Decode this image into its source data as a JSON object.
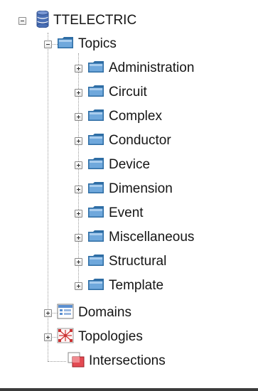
{
  "tree": {
    "root": {
      "label": "TTELECTRIC",
      "icon": "database-icon",
      "expanded": true
    },
    "topics": {
      "label": "Topics",
      "icon": "folder-icon",
      "expanded": true,
      "children": [
        {
          "label": "Administration"
        },
        {
          "label": "Circuit"
        },
        {
          "label": "Complex"
        },
        {
          "label": "Conductor"
        },
        {
          "label": "Device"
        },
        {
          "label": "Dimension"
        },
        {
          "label": "Event"
        },
        {
          "label": "Miscellaneous"
        },
        {
          "label": "Structural"
        },
        {
          "label": "Template"
        }
      ]
    },
    "domains": {
      "label": "Domains",
      "icon": "domains-icon"
    },
    "topologies": {
      "label": "Topologies",
      "icon": "topologies-icon"
    },
    "intersections": {
      "label": "Intersections",
      "icon": "intersections-icon"
    }
  },
  "colors": {
    "folder": "#5b9bd5",
    "folder_dark": "#2e6da4",
    "database": "#4a6fb5",
    "topology": "#cc3333",
    "intersection": "#d9303a"
  }
}
